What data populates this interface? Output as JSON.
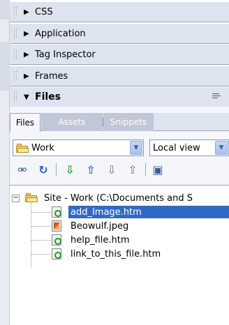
{
  "panels": [
    {
      "title": "CSS",
      "expanded": false
    },
    {
      "title": "Application",
      "expanded": false
    },
    {
      "title": "Tag Inspector",
      "expanded": false
    },
    {
      "title": "Frames",
      "expanded": false
    },
    {
      "title": "Files",
      "expanded": true
    }
  ],
  "files_panel": {
    "tabs": [
      {
        "label": "Files",
        "active": true
      },
      {
        "label": "Assets",
        "active": false
      },
      {
        "label": "Snippets",
        "active": false
      }
    ],
    "site_select": {
      "value": "Work",
      "icon": "folder-icon"
    },
    "view_select": {
      "value": "Local view"
    },
    "toolbar_icons": [
      "connect-icon",
      "refresh-icon",
      "get-files-icon",
      "put-files-icon",
      "check-out-icon",
      "check-in-icon",
      "expand-icon"
    ],
    "tree": {
      "root": {
        "label": "Site - Work (C:\\Documents and S",
        "expanded": true,
        "icon": "folder-icon"
      },
      "items": [
        {
          "label": "add_Image.htm",
          "type": "htm",
          "selected": true
        },
        {
          "label": "Beowulf.jpeg",
          "type": "jpeg",
          "selected": false
        },
        {
          "label": "help_file.htm",
          "type": "htm",
          "selected": false
        },
        {
          "label": "link_to_this_file.htm",
          "type": "htm",
          "selected": false
        }
      ]
    }
  },
  "colors": {
    "header": "#dde3ef",
    "selection": "#316ac5",
    "tab_inactive": "#bfc7d8"
  }
}
